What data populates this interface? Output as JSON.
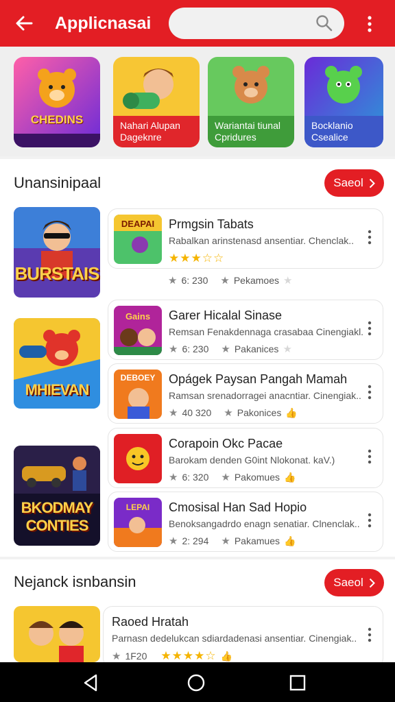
{
  "appbar": {
    "title": "Applicnasai",
    "search_placeholder": ""
  },
  "featured": [
    {
      "big_text": "CHEDINS",
      "label": ""
    },
    {
      "label": "Nahari Alupan Dageknre"
    },
    {
      "label": "Wariantai tiunal Cpridures"
    },
    {
      "label": "Bocklanio Csealice"
    }
  ],
  "section1": {
    "title": "Unansinipaal",
    "see_all": "Saeol",
    "big_art": [
      "BURSTAIS",
      "MHIEVAN",
      "BKODMAY CONTIES"
    ],
    "cards": [
      {
        "title": "Prmgsin Tabats",
        "desc": "Rabalkan arinstenasd ansentiar. Chenclak..",
        "stars": "★★★☆☆",
        "rating": "6: 230",
        "tag": "Pekamoes",
        "thumb_text": "DEAPAI"
      },
      {
        "title": "Garer Hicalal Sinase",
        "desc": "Remsan Fenakdennaga crasabaa Cinengiakl.",
        "rating": "6: 230",
        "tag": "Pakanices",
        "thumb_text": "Gains"
      },
      {
        "title": "Opágek Paysan Pangah Mamah",
        "desc": "Ramsan srenadorragei anacntiar. Cinengiak..",
        "rating": "40 320",
        "tag": "Pakonices",
        "thumb_text": "DEBOEY"
      },
      {
        "title": "Corapoin Okc Pacae",
        "desc": "Barokam denden G0int Nlokonat. kaV.)",
        "rating": "6: 320",
        "tag": "Pakomues",
        "thumb_text": ""
      },
      {
        "title": "Cmosisal Han Sad Hopio",
        "desc": "Benoksangadrdo enagn senatiar. Clnenclak..",
        "rating": "2: 294",
        "tag": "Pakamues",
        "thumb_text": "LEPAI"
      }
    ]
  },
  "section2": {
    "title": "Nejanck isnbansin",
    "see_all": "Saeol",
    "card": {
      "title": "Raoed Hratah",
      "desc": "Parnasn dedelukcan sdiardadenasi ansentiar. Cinengiak..",
      "rating": "1F20",
      "stars": "★★★★☆"
    }
  },
  "colors": {
    "brand": "#e31e24",
    "star": "#f5b400"
  },
  "icons": [
    "back-arrow-icon",
    "search-icon",
    "more-vert-icon",
    "chevron-right-icon",
    "star-icon",
    "nav-back-icon",
    "nav-home-icon",
    "nav-recents-icon"
  ]
}
